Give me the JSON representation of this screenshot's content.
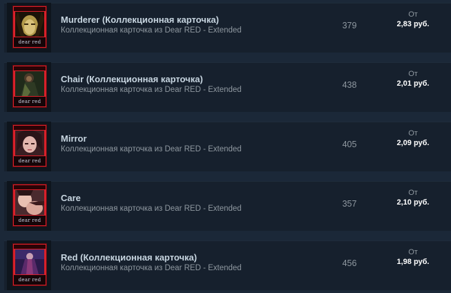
{
  "listings": [
    {
      "name": "Murderer (Коллекционная карточка)",
      "game": "Коллекционная карточка из Dear RED - Extended",
      "quantity": "379",
      "from_label": "От",
      "price": "2,83 руб.",
      "card_logo": "dear red",
      "art": "face-yellow"
    },
    {
      "name": "Chair (Коллекционная карточка)",
      "game": "Коллекционная карточка из Dear RED - Extended",
      "quantity": "438",
      "from_label": "От",
      "price": "2,01 руб.",
      "card_logo": "dear red",
      "art": "figure-dark-green"
    },
    {
      "name": "Mirror",
      "game": "Коллекционная карточка из Dear RED - Extended",
      "quantity": "405",
      "from_label": "От",
      "price": "2,09 руб.",
      "card_logo": "dear red",
      "art": "face-pink"
    },
    {
      "name": "Care",
      "game": "Коллекционная карточка из Dear RED - Extended",
      "quantity": "357",
      "from_label": "От",
      "price": "2,10 руб.",
      "card_logo": "dear red",
      "art": "faces-pink"
    },
    {
      "name": "Red (Коллекционная карточка)",
      "game": "Коллекционная карточка из Dear RED - Extended",
      "quantity": "456",
      "from_label": "От",
      "price": "1,98 руб.",
      "card_logo": "dear red",
      "art": "figure-purple"
    }
  ]
}
